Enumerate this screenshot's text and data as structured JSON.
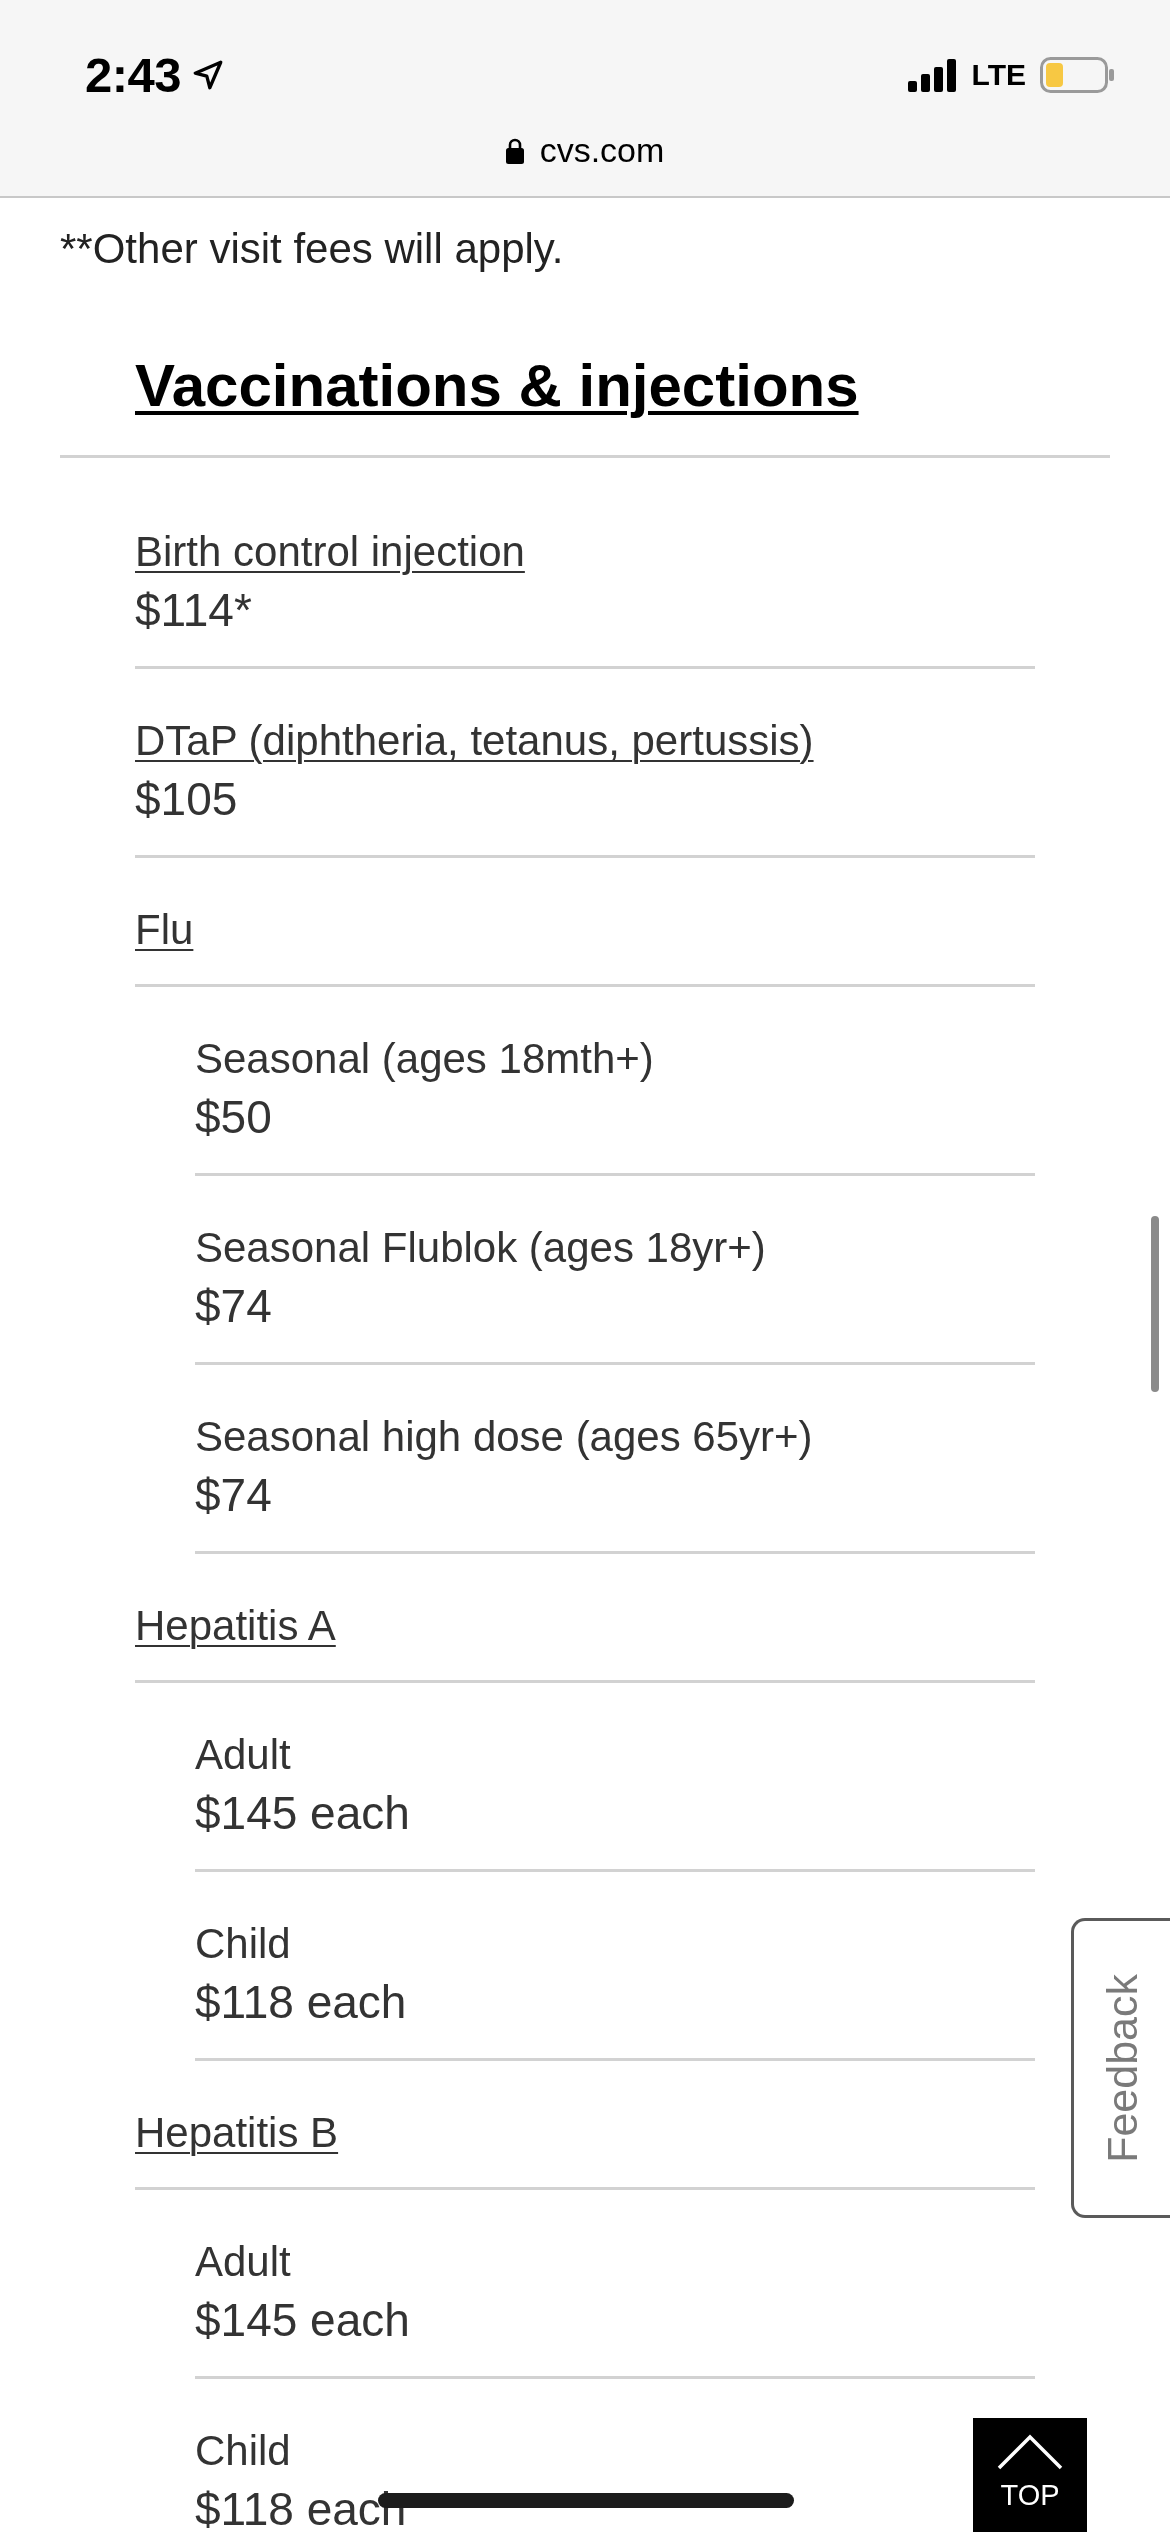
{
  "status_bar": {
    "time": "2:43",
    "network": "LTE"
  },
  "address_bar": {
    "url": "cvs.com"
  },
  "footnote": "**Other visit fees will apply.",
  "section": {
    "title": "Vaccinations & injections",
    "items": [
      {
        "label": "Birth control injection",
        "price": "$114*"
      },
      {
        "label": "DTaP (diphtheria, tetanus, pertussis)",
        "price": "$105"
      },
      {
        "label": "Flu",
        "children": [
          {
            "label": "Seasonal (ages 18mth+)",
            "price": "$50"
          },
          {
            "label": "Seasonal Flublok (ages 18yr+)",
            "price": "$74"
          },
          {
            "label": "Seasonal high dose (ages 65yr+)",
            "price": "$74"
          }
        ]
      },
      {
        "label": "Hepatitis A",
        "children": [
          {
            "label": "Adult",
            "price": "$145 each"
          },
          {
            "label": "Child",
            "price": "$118 each"
          }
        ]
      },
      {
        "label": "Hepatitis B",
        "children": [
          {
            "label": "Adult",
            "price": "$145 each"
          },
          {
            "label": "Child",
            "price": "$118 each"
          }
        ]
      }
    ]
  },
  "feedback_tab": {
    "label": "Feedback"
  },
  "top_button": {
    "label": "TOP"
  }
}
